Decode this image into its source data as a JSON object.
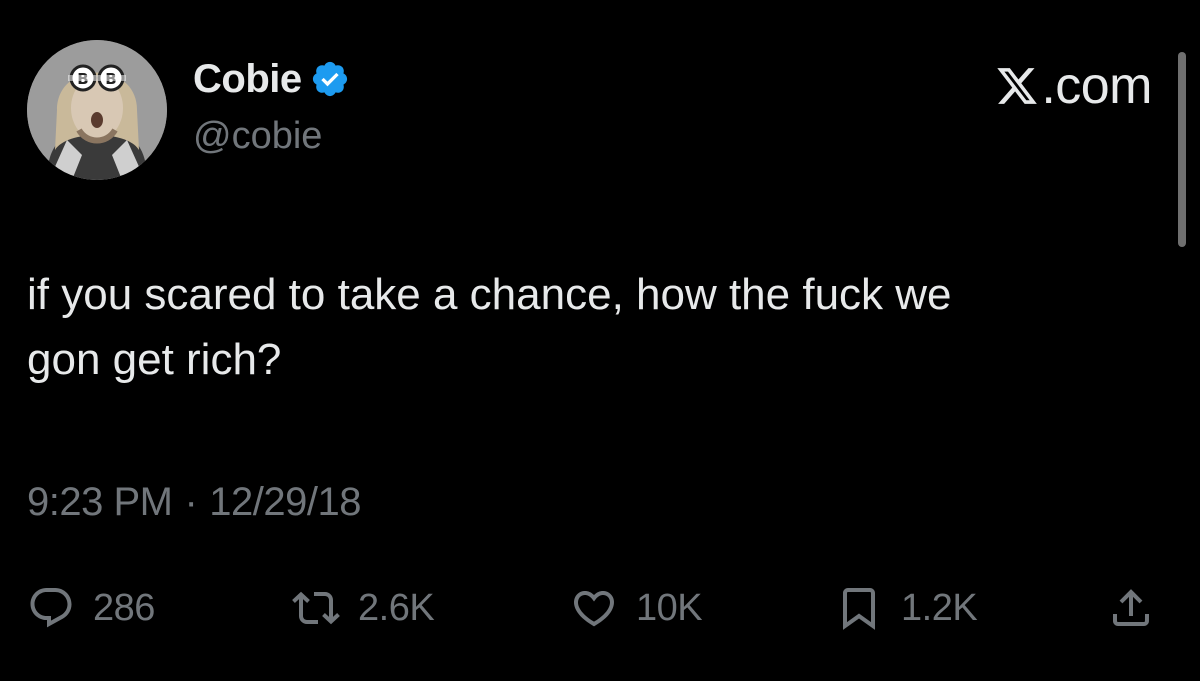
{
  "author": {
    "display_name": "Cobie",
    "handle": "@cobie",
    "verified": true,
    "verified_color": "#1d9bf0",
    "avatar_icon": "avatar-photo"
  },
  "brand": {
    "logo_icon": "x-logo-icon",
    "suffix": ".com"
  },
  "tweet": {
    "text": "if you scared to take a chance, how the fuck we\ngon get rich?",
    "time": "9:23 PM",
    "separator": "·",
    "date": "12/29/18"
  },
  "actions": {
    "replies": "286",
    "reposts": "2.6K",
    "likes": "10K",
    "bookmarks": "1.2K"
  },
  "colors": {
    "background": "#000000",
    "primary_text": "#e7e9ea",
    "secondary_text": "#71767b"
  }
}
